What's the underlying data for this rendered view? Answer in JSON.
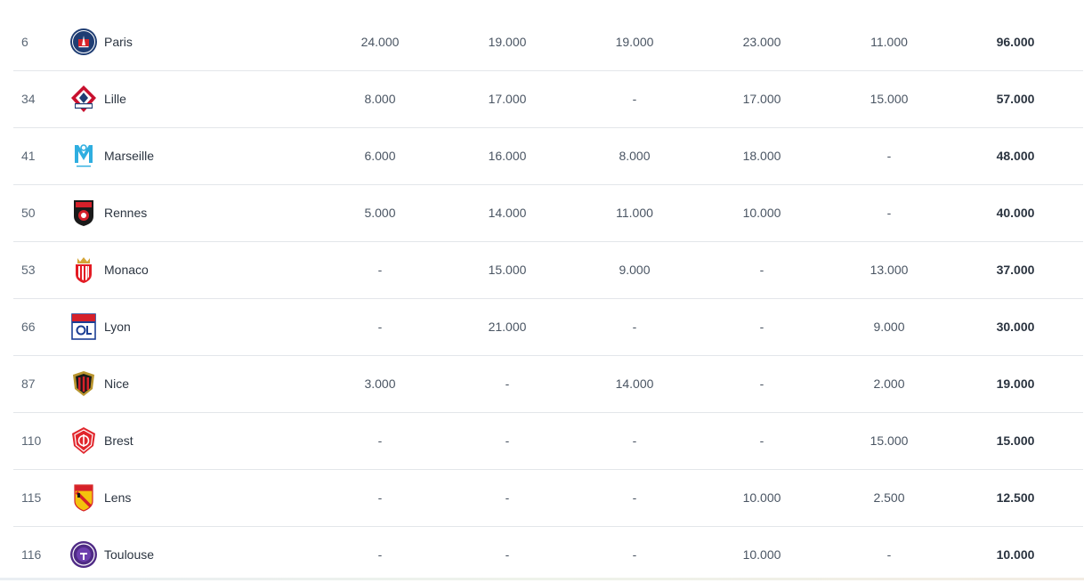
{
  "rows": [
    {
      "rank": "6",
      "club": "Paris",
      "logo": "psg-crest-icon",
      "v1": "24.000",
      "v2": "19.000",
      "v3": "19.000",
      "v4": "23.000",
      "v5": "11.000",
      "total": "96.000"
    },
    {
      "rank": "34",
      "club": "Lille",
      "logo": "lille-crest-icon",
      "v1": "8.000",
      "v2": "17.000",
      "v3": "-",
      "v4": "17.000",
      "v5": "15.000",
      "total": "57.000"
    },
    {
      "rank": "41",
      "club": "Marseille",
      "logo": "marseille-crest-icon",
      "v1": "6.000",
      "v2": "16.000",
      "v3": "8.000",
      "v4": "18.000",
      "v5": "-",
      "total": "48.000"
    },
    {
      "rank": "50",
      "club": "Rennes",
      "logo": "rennes-crest-icon",
      "v1": "5.000",
      "v2": "14.000",
      "v3": "11.000",
      "v4": "10.000",
      "v5": "-",
      "total": "40.000"
    },
    {
      "rank": "53",
      "club": "Monaco",
      "logo": "monaco-crest-icon",
      "v1": "-",
      "v2": "15.000",
      "v3": "9.000",
      "v4": "-",
      "v5": "13.000",
      "total": "37.000"
    },
    {
      "rank": "66",
      "club": "Lyon",
      "logo": "lyon-crest-icon",
      "v1": "-",
      "v2": "21.000",
      "v3": "-",
      "v4": "-",
      "v5": "9.000",
      "total": "30.000"
    },
    {
      "rank": "87",
      "club": "Nice",
      "logo": "nice-crest-icon",
      "v1": "3.000",
      "v2": "-",
      "v3": "14.000",
      "v4": "-",
      "v5": "2.000",
      "total": "19.000"
    },
    {
      "rank": "110",
      "club": "Brest",
      "logo": "brest-crest-icon",
      "v1": "-",
      "v2": "-",
      "v3": "-",
      "v4": "-",
      "v5": "15.000",
      "total": "15.000"
    },
    {
      "rank": "115",
      "club": "Lens",
      "logo": "lens-crest-icon",
      "v1": "-",
      "v2": "-",
      "v3": "-",
      "v4": "10.000",
      "v5": "2.500",
      "total": "12.500"
    },
    {
      "rank": "116",
      "club": "Toulouse",
      "logo": "toulouse-crest-icon",
      "v1": "-",
      "v2": "-",
      "v3": "-",
      "v4": "10.000",
      "v5": "-",
      "total": "10.000"
    }
  ],
  "colors": {
    "text_primary": "#2b3440",
    "text_secondary": "#5b6775",
    "divider": "#e3e6ea",
    "psg_blue": "#1f3d73",
    "psg_red": "#d8232a",
    "lille_red": "#c8102e",
    "om_blue": "#2faee0",
    "rennes_red": "#d6202a",
    "lyon_blue": "#1c3f94",
    "toulouse_purple": "#4f2a85",
    "lens_yellow": "#f4c20d"
  }
}
